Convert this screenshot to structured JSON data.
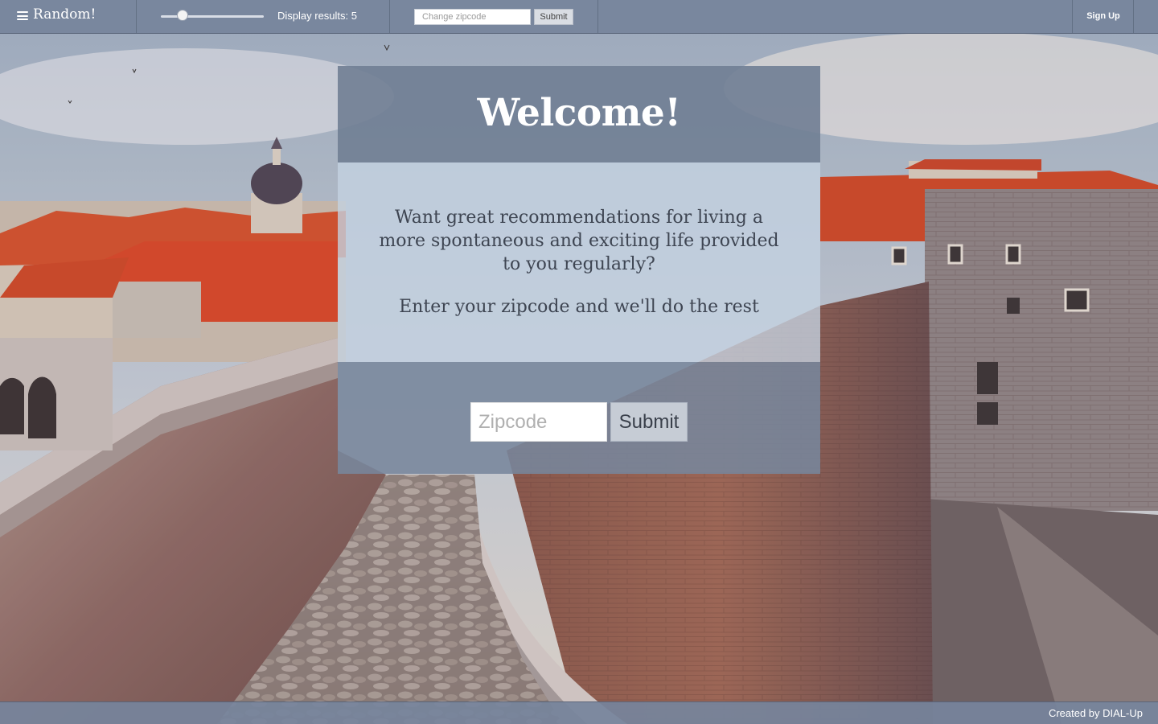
{
  "nav": {
    "brand_label": "Random!",
    "menu_icon": "hamburger-menu-icon",
    "slider": {
      "min": 1,
      "max": 20,
      "value": 5
    },
    "display_label": "Display results: 5",
    "zip_placeholder": "Change zipcode",
    "zip_submit_label": "Submit",
    "signup_label": "Sign Up"
  },
  "card": {
    "title": "Welcome!",
    "text_primary": "Want great recommendations for living a more spontaneous and exciting life provided to you regularly?",
    "text_secondary": "Enter your zipcode and we'll do the rest",
    "zip_placeholder": "Zipcode",
    "submit_label": "Submit"
  },
  "footer": {
    "credit": "Created by DIAL-Up"
  },
  "colors": {
    "nav_bg": "#76849c",
    "card_header_bg": "#707e94",
    "card_body_bg": "#c4d2e2",
    "card_form_bg": "#78869c",
    "roof_red": "#d4482a",
    "stone": "#8a7068"
  }
}
